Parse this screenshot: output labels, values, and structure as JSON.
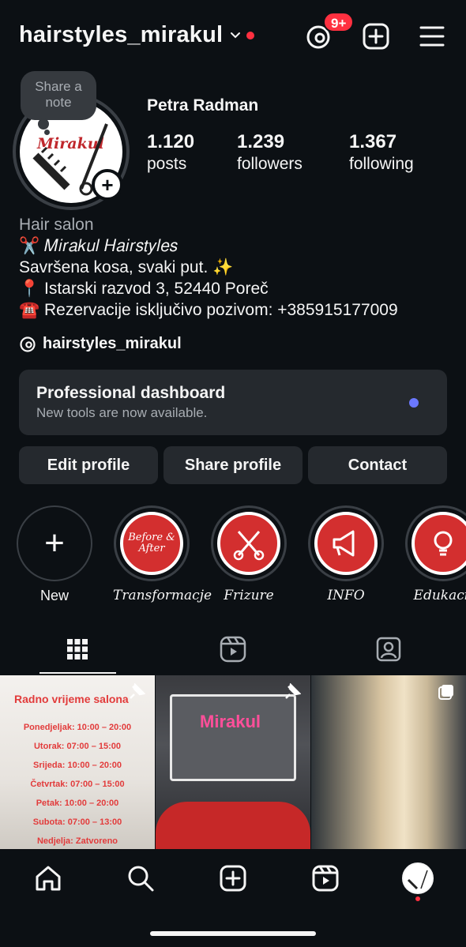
{
  "header": {
    "username": "hairstyles_mirakul",
    "notification_badge": "9+",
    "accent_red": "#ff3040"
  },
  "profile": {
    "note_label": "Share a note",
    "avatar_brand": "Mirakul",
    "full_name": "Petra Radman",
    "stats": [
      {
        "num": "1.120",
        "label": "posts"
      },
      {
        "num": "1.239",
        "label": "followers"
      },
      {
        "num": "1.367",
        "label": "following"
      }
    ],
    "bio": {
      "category": "Hair salon",
      "line1": "✂️ 𝑀𝑖𝑟𝑎𝑘𝑢𝑙 𝐻𝑎𝑖𝑟𝑠𝑡𝑦𝑙𝑒𝑠",
      "line2": "Savršena kosa, svaki put. ✨",
      "line3": "📍 Istarski razvod 3, 52440 Poreč",
      "line4": "☎️ Rezervacije isključivo pozivom: +385915177009"
    },
    "threads_handle": "hairstyles_mirakul"
  },
  "dashboard": {
    "title": "Professional dashboard",
    "subtitle": "New tools are now available.",
    "dot_color": "#6b78ff"
  },
  "buttons": {
    "edit": "Edit profile",
    "share": "Share profile",
    "contact": "Contact"
  },
  "highlights": [
    {
      "label": "New"
    },
    {
      "label": "Transformacje",
      "cover": "Before & After"
    },
    {
      "label": "Frizure"
    },
    {
      "label": "INFO"
    },
    {
      "label": "Edukacij"
    }
  ],
  "tabs": {
    "active": "grid",
    "items": [
      "grid-icon",
      "reels-icon",
      "tagged-icon"
    ]
  },
  "grid": {
    "post1": {
      "title": "Radno vrijeme salona",
      "lines": [
        "Ponedjeljak: 10:00 – 20:00",
        "Utorak: 07:00 – 15:00",
        "Srijeda: 10:00 – 20:00",
        "Četvrtak: 07:00 – 15:00",
        "Petak: 10:00 – 20:00",
        "Subota: 07:00 – 13:00",
        "Nedjelja: Zatvoreno"
      ]
    },
    "post2": {
      "text": "Mirakul"
    }
  },
  "bottom_nav": {
    "items": [
      "home-icon",
      "search-icon",
      "create-icon",
      "reels-icon",
      "profile-avatar"
    ]
  }
}
